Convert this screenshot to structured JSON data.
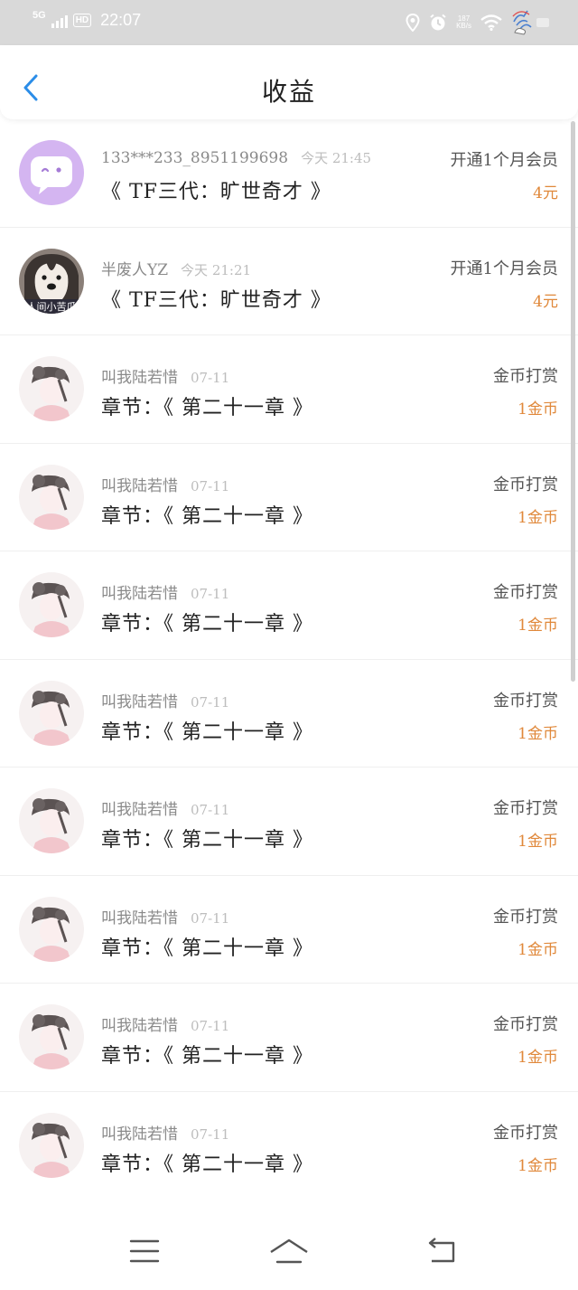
{
  "status_bar": {
    "network": "5G",
    "hd": "HD",
    "time": "22:07",
    "speed_value": "187",
    "speed_unit": "KB/s"
  },
  "header": {
    "title": "收益",
    "accent_color": "#2b8de8"
  },
  "records": [
    {
      "avatar": "chat-bubble-avatar",
      "name": "133***233_8951199698",
      "time": "今天 21:45",
      "text": "《 TF三代：旷世奇才 》",
      "type": "开通1个月会员",
      "amount": "4元"
    },
    {
      "avatar": "dog-avatar",
      "avatar_caption": "人间小苦瓜",
      "name": "半废人YZ",
      "time": "今天 21:21",
      "text": "《 TF三代：旷世奇才 》",
      "type": "开通1个月会员",
      "amount": "4元"
    },
    {
      "avatar": "girl-avatar",
      "name": "叫我陆若惜",
      "time": "07-11",
      "text": "章节：《 第二十一章 》",
      "type": "金币打赏",
      "amount": "1金币"
    },
    {
      "avatar": "girl-avatar",
      "name": "叫我陆若惜",
      "time": "07-11",
      "text": "章节：《 第二十一章 》",
      "type": "金币打赏",
      "amount": "1金币"
    },
    {
      "avatar": "girl-avatar",
      "name": "叫我陆若惜",
      "time": "07-11",
      "text": "章节：《 第二十一章 》",
      "type": "金币打赏",
      "amount": "1金币"
    },
    {
      "avatar": "girl-avatar",
      "name": "叫我陆若惜",
      "time": "07-11",
      "text": "章节：《 第二十一章 》",
      "type": "金币打赏",
      "amount": "1金币"
    },
    {
      "avatar": "girl-avatar",
      "name": "叫我陆若惜",
      "time": "07-11",
      "text": "章节：《 第二十一章 》",
      "type": "金币打赏",
      "amount": "1金币"
    },
    {
      "avatar": "girl-avatar",
      "name": "叫我陆若惜",
      "time": "07-11",
      "text": "章节：《 第二十一章 》",
      "type": "金币打赏",
      "amount": "1金币"
    },
    {
      "avatar": "girl-avatar",
      "name": "叫我陆若惜",
      "time": "07-11",
      "text": "章节：《 第二十一章 》",
      "type": "金币打赏",
      "amount": "1金币"
    },
    {
      "avatar": "girl-avatar",
      "name": "叫我陆若惜",
      "time": "07-11",
      "text": "章节：《 第二十一章 》",
      "type": "金币打赏",
      "amount": "1金币"
    }
  ],
  "nav_bar": {
    "icons": [
      "menu-icon",
      "home-icon",
      "back-icon"
    ]
  }
}
